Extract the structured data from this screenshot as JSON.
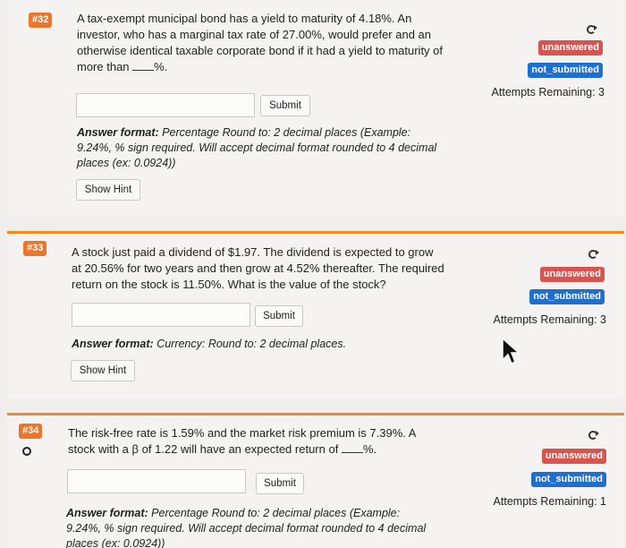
{
  "questions": [
    {
      "number": "#32",
      "text_lines": [
        "A tax-exempt municipal bond has a yield to maturity of 4.18%. An",
        "investor, who has a marginal tax rate of 27.00%, would prefer and an",
        "otherwise identical taxable corporate bond if it had a yield to maturity of",
        "more than"
      ],
      "text_suffix": "%.",
      "status": "unanswered",
      "submission": "not_submitted",
      "attempts": "Attempts Remaining: 3",
      "submit_label": "Submit",
      "format_label": "Answer format:",
      "format_lines": [
        "Percentage Round to: 2 decimal places (Example:",
        "9.24%, % sign required. Will accept decimal format rounded to 4 decimal",
        "places (ex: 0.0924))"
      ],
      "hint_label": "Show Hint"
    },
    {
      "number": "#33",
      "text_lines": [
        "A stock just paid a dividend of $1.97. The dividend is expected to grow",
        "at 20.56% for two years and then grow at 4.52% thereafter. The required",
        "return on the stock is 11.50%. What is the value of the stock?"
      ],
      "status": "unanswered",
      "submission": "not_submitted",
      "attempts": "Attempts Remaining: 3",
      "submit_label": "Submit",
      "format_label": "Answer format:",
      "format_lines": [
        "Currency: Round to: 2 decimal places."
      ],
      "hint_label": "Show Hint"
    },
    {
      "number": "#34",
      "text_lines": [
        "The risk-free rate is 1.59% and the market risk premium is 7.39%. A",
        "stock with a β of 1.22 will have an expected return of"
      ],
      "text_suffix": "%.",
      "status": "unanswered",
      "submission": "not_submitted",
      "attempts": "Attempts Remaining: 1",
      "submit_label": "Submit",
      "format_label": "Answer format:",
      "format_lines": [
        "Percentage Round to: 2 decimal places (Example:",
        "9.24%, % sign required. Will accept decimal format rounded to 4 decimal",
        "places (ex: 0.0924))"
      ]
    }
  ],
  "colors": {
    "accent": "#ef8b1f",
    "question_badge": "#e9762b",
    "unanswered": "#d9534f",
    "not_submitted": "#1f6fd1"
  },
  "icons": [
    "refresh-icon",
    "circle-icon",
    "mouse-cursor-icon"
  ]
}
